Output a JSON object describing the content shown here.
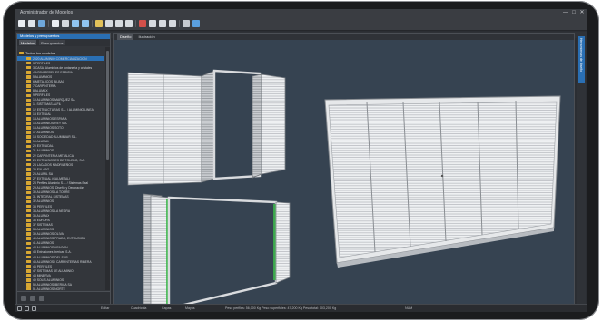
{
  "window": {
    "title": "Administrador de Modelos",
    "controls": [
      "—",
      "□",
      "✕"
    ]
  },
  "toolbar": {
    "icons": [
      "new-icon",
      "open-icon",
      "save-icon",
      "grid-icon",
      "print-icon",
      "undo-icon",
      "redo-icon",
      "model-icon",
      "cut-icon",
      "copy-icon",
      "paste-icon",
      "delete-icon",
      "shape-icon",
      "profile-icon",
      "measure-icon",
      "settings-icon",
      "info-icon"
    ]
  },
  "left_panel": {
    "header": "Modelos y presupuestos",
    "tabs": [
      {
        "label": "Modelos",
        "active": true
      },
      {
        "label": "Presupuestos",
        "active": false
      }
    ],
    "root_label": "Todos los modelos",
    "items": [
      "2020 ALUMINIO COMERCIALIZACION",
      "3 PERFILES",
      "3 CASA, Aluminios de fontaneria y cristales",
      "4 AGRA PERFILES ESPAÑA",
      "5 ALUMINIOS",
      "6 METALICOS BILBAO",
      "7 CARPINTERIA",
      "8 ALUMAX",
      "9 PERFILES",
      "10 ALUMINIOS MARQUEZ SA",
      "11 SISTEMAS ALFIL",
      "12 ESTRUCTURAS S.L. / ALUMINIO LINEA",
      "13 EXTRUAL",
      "14 ALUMINIOS ESPAÑA",
      "15 ALUMINIOS REY S.A.",
      "16 ALUMINIOS SOTO",
      "17 ALUMINIOS",
      "18 SOCIEDAD ALUMINIAR S.L.",
      "19 ALUMAX",
      "20 EXTRUDAL",
      "21 ALUMINIOS",
      "22 CARPINTERIA METALICA",
      "23 EXTRUSIONES DE TOLEDO, S.A.",
      "24 LACADOS MADRILEÑOS",
      "25 EXLABO",
      "26 ALUMIL SA",
      "27 EXTRUAL (GALMETAL)",
      "28 Perfiles Aluminio S.L. / Sistemas Exal",
      "29 ALUMINIOS, Diseño y Decoración",
      "30 ALUMINIOS LA TORRE",
      "31 INTEGRAL SISTEMAS",
      "32 ALUMINIOS",
      "33 PERFILES",
      "34 ALUMINIOS LA NEGRA",
      "35 ALUMAX",
      "36 EUROPA",
      "37 SISTEMAS",
      "38 ALUMINIOS",
      "39 ALUMINIOS OLIVA",
      "40 ALUMINIOS PRADO, EXTRUSION",
      "41 ALUMINIOS",
      "42 ALUMINIOS ARAGON",
      "43 Extrusiones Ibericas S.A.",
      "44 ALUMINIOS DEL SUR",
      "45 ALUMINIOS / CARPINTERIAS RIBERA",
      "46 PERFILES",
      "47 SISTEMAS DE ALUMINIO",
      "48 MINERVA",
      "49 SOLIS ALUMINIOS",
      "50 ALUMINIOS IBERICA SA",
      "51 ALUMINIOS NORTE",
      "52 ALUMINIOS S.L.",
      "53 TECNOALUMINIO",
      "54 SOLIDO",
      "55 SISTEMAS ALUMINIO",
      "56 PERFILES",
      "57 ALUMINIOS NORTE, S.A."
    ],
    "selected_index": 0
  },
  "right_panel": {
    "tab": "Herramientas de diseño"
  },
  "viewport": {
    "tabs": [
      {
        "label": "Diseño",
        "active": true
      },
      {
        "label": "Ilustración",
        "active": false
      }
    ]
  },
  "status": {
    "items": [
      "Editar",
      "Cuadrícula",
      "Capas",
      "Mayús"
    ],
    "weights": "Peso perfiles: 56,000 Kg   Peso superficies: 47,200 Kg   Peso total: 103,200 Kg",
    "mode": "NUM"
  },
  "colors": {
    "accent": "#2a6fb3",
    "viewport_bg": "#364351",
    "frame": "#e6e8ea",
    "folder": "#d7a733",
    "hinge_green": "#3bb54a"
  }
}
